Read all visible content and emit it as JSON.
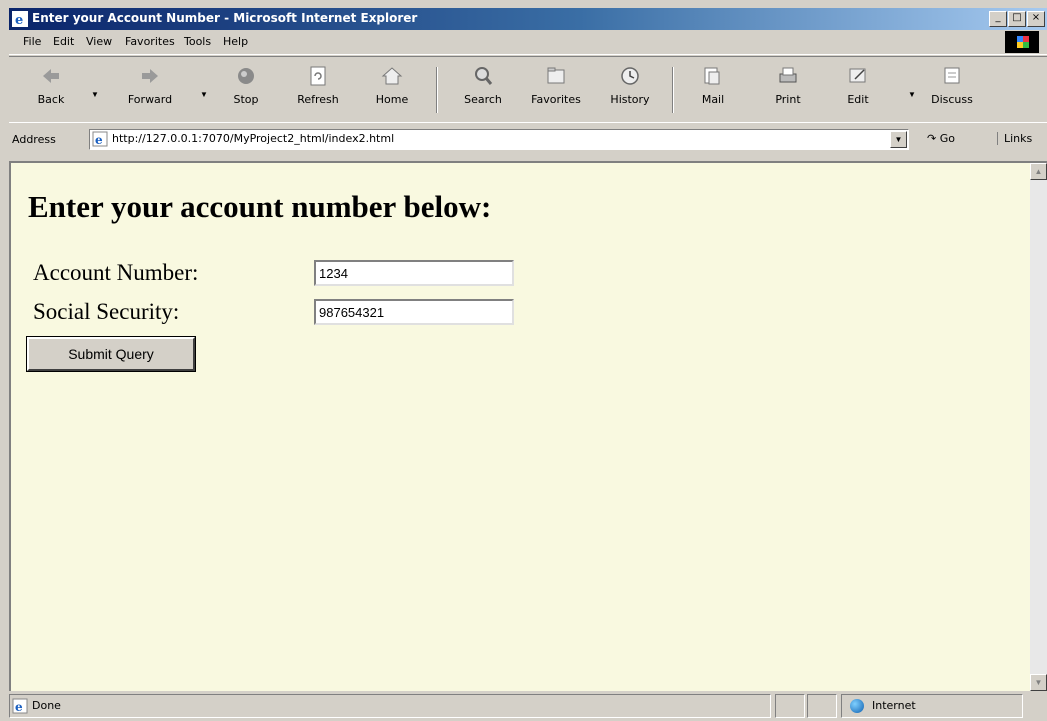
{
  "window": {
    "title": "Enter your Account Number - Microsoft Internet Explorer",
    "controls": {
      "minimize": "_",
      "maximize": "□",
      "close": "×"
    }
  },
  "menubar": {
    "items": [
      {
        "label": "File",
        "accel": "F"
      },
      {
        "label": "Edit",
        "accel": "E"
      },
      {
        "label": "View",
        "accel": "V"
      },
      {
        "label": "Favorites",
        "accel": "a"
      },
      {
        "label": "Tools",
        "accel": "T"
      },
      {
        "label": "Help",
        "accel": "H"
      }
    ]
  },
  "toolbar": {
    "back": "Back",
    "forward": "Forward",
    "stop": "Stop",
    "refresh": "Refresh",
    "home": "Home",
    "search": "Search",
    "favorites": "Favorites",
    "history": "History",
    "mail": "Mail",
    "print": "Print",
    "edit": "Edit",
    "discuss": "Discuss"
  },
  "address": {
    "label": "Address",
    "url": "http://127.0.0.1:7070/MyProject2_html/index2.html",
    "go": "Go",
    "links": "Links"
  },
  "page": {
    "heading": "Enter your account number below:",
    "account_label": "Account Number:",
    "account_value": "1234",
    "ssn_label": "Social Security:",
    "ssn_value": "987654321",
    "submit_label": "Submit Query"
  },
  "statusbar": {
    "text": "Done",
    "zone": "Internet"
  },
  "colors": {
    "page_background": "#f9f9e0",
    "chrome": "#d4d0c8",
    "titlebar_start": "#0a246a"
  }
}
